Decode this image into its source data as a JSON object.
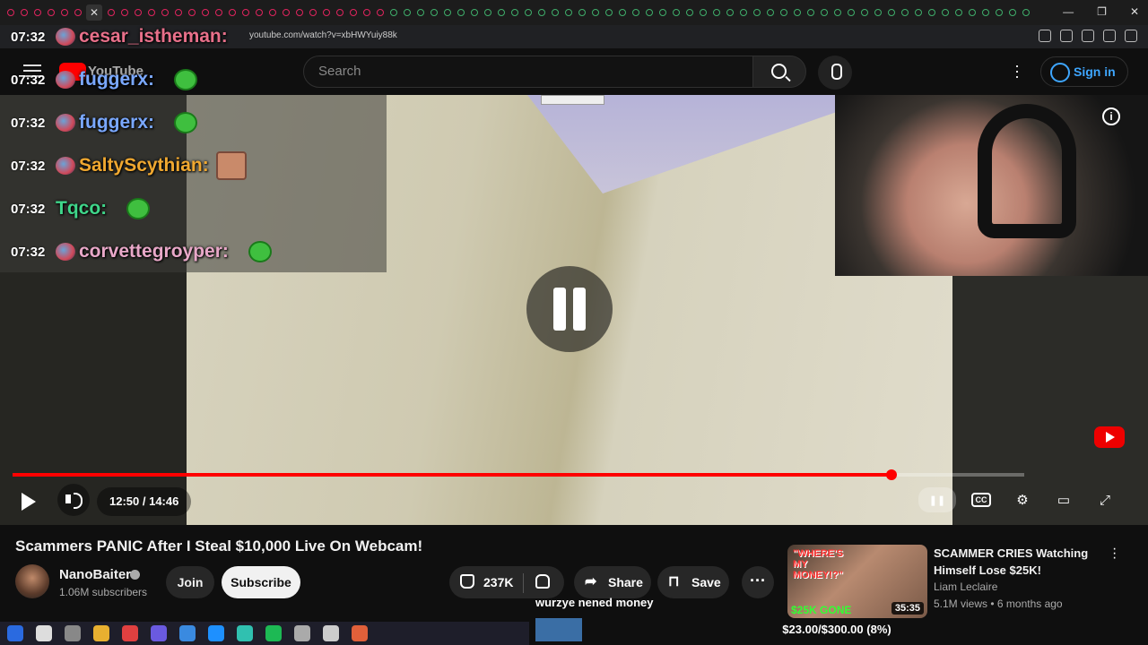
{
  "browser": {
    "url": "youtube.com/watch?v=xbHWYuiy88k"
  },
  "youtube": {
    "logo_text": "YouTube",
    "search_placeholder": "Search",
    "signin_label": "Sign in"
  },
  "chat": {
    "messages": [
      {
        "time": "07:32",
        "user": "cesar_istheman:",
        "color": "#e8708a"
      },
      {
        "time": "07:32",
        "user": "fuggerx:",
        "color": "#7aa8ff"
      },
      {
        "time": "07:32",
        "user": "fuggerx:",
        "color": "#7aa8ff"
      },
      {
        "time": "07:32",
        "user": "SaltyScythian:",
        "color": "#f0a830"
      },
      {
        "time": "07:32",
        "user": "Tqco:",
        "color": "#3fd68a"
      },
      {
        "time": "07:32",
        "user": "corvettegroyper:",
        "color": "#e8a8c8"
      }
    ]
  },
  "player": {
    "current_time": "12:50 / 14:46",
    "progress_fraction": 0.8691,
    "accent": "#ff0000"
  },
  "video": {
    "title": "Scammers PANIC After I Steal $10,000 Live On Webcam!",
    "channel": "NanoBaiter",
    "subscribers": "1.06M subscribers",
    "join_label": "Join",
    "subscribe_label": "Subscribe",
    "likes": "237K",
    "share_label": "Share",
    "save_label": "Save"
  },
  "recommendation": {
    "thumb_text": "\"WHERE'S MY MONEY!?\"",
    "thumb_money": "$25K GONE",
    "duration": "35:35",
    "title": "SCAMMER CRIES Watching Himself Lose $25K!",
    "channel": "Liam Leclaire",
    "meta": "5.1M views • 6 months ago"
  },
  "donation": {
    "message": "wurzye nened money",
    "goal": "$23.00/$300.00 (8%)",
    "goal_fraction": 0.0767
  }
}
